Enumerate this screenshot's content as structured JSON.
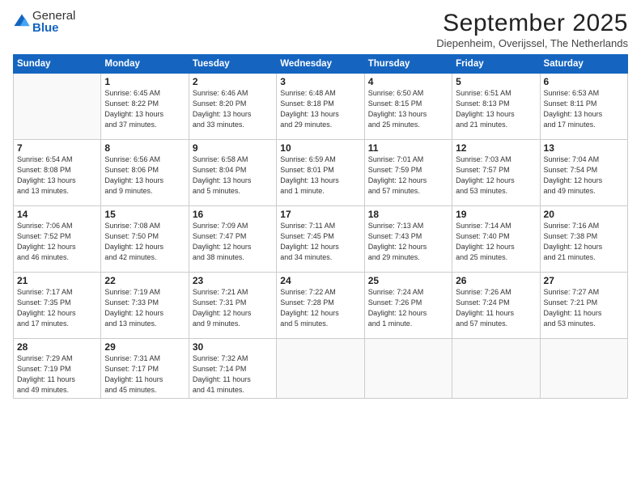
{
  "logo": {
    "general": "General",
    "blue": "Blue"
  },
  "title": "September 2025",
  "subtitle": "Diepenheim, Overijssel, The Netherlands",
  "days_of_week": [
    "Sunday",
    "Monday",
    "Tuesday",
    "Wednesday",
    "Thursday",
    "Friday",
    "Saturday"
  ],
  "weeks": [
    [
      {
        "day": "",
        "info": ""
      },
      {
        "day": "1",
        "info": "Sunrise: 6:45 AM\nSunset: 8:22 PM\nDaylight: 13 hours\nand 37 minutes."
      },
      {
        "day": "2",
        "info": "Sunrise: 6:46 AM\nSunset: 8:20 PM\nDaylight: 13 hours\nand 33 minutes."
      },
      {
        "day": "3",
        "info": "Sunrise: 6:48 AM\nSunset: 8:18 PM\nDaylight: 13 hours\nand 29 minutes."
      },
      {
        "day": "4",
        "info": "Sunrise: 6:50 AM\nSunset: 8:15 PM\nDaylight: 13 hours\nand 25 minutes."
      },
      {
        "day": "5",
        "info": "Sunrise: 6:51 AM\nSunset: 8:13 PM\nDaylight: 13 hours\nand 21 minutes."
      },
      {
        "day": "6",
        "info": "Sunrise: 6:53 AM\nSunset: 8:11 PM\nDaylight: 13 hours\nand 17 minutes."
      }
    ],
    [
      {
        "day": "7",
        "info": "Sunrise: 6:54 AM\nSunset: 8:08 PM\nDaylight: 13 hours\nand 13 minutes."
      },
      {
        "day": "8",
        "info": "Sunrise: 6:56 AM\nSunset: 8:06 PM\nDaylight: 13 hours\nand 9 minutes."
      },
      {
        "day": "9",
        "info": "Sunrise: 6:58 AM\nSunset: 8:04 PM\nDaylight: 13 hours\nand 5 minutes."
      },
      {
        "day": "10",
        "info": "Sunrise: 6:59 AM\nSunset: 8:01 PM\nDaylight: 13 hours\nand 1 minute."
      },
      {
        "day": "11",
        "info": "Sunrise: 7:01 AM\nSunset: 7:59 PM\nDaylight: 12 hours\nand 57 minutes."
      },
      {
        "day": "12",
        "info": "Sunrise: 7:03 AM\nSunset: 7:57 PM\nDaylight: 12 hours\nand 53 minutes."
      },
      {
        "day": "13",
        "info": "Sunrise: 7:04 AM\nSunset: 7:54 PM\nDaylight: 12 hours\nand 49 minutes."
      }
    ],
    [
      {
        "day": "14",
        "info": "Sunrise: 7:06 AM\nSunset: 7:52 PM\nDaylight: 12 hours\nand 46 minutes."
      },
      {
        "day": "15",
        "info": "Sunrise: 7:08 AM\nSunset: 7:50 PM\nDaylight: 12 hours\nand 42 minutes."
      },
      {
        "day": "16",
        "info": "Sunrise: 7:09 AM\nSunset: 7:47 PM\nDaylight: 12 hours\nand 38 minutes."
      },
      {
        "day": "17",
        "info": "Sunrise: 7:11 AM\nSunset: 7:45 PM\nDaylight: 12 hours\nand 34 minutes."
      },
      {
        "day": "18",
        "info": "Sunrise: 7:13 AM\nSunset: 7:43 PM\nDaylight: 12 hours\nand 29 minutes."
      },
      {
        "day": "19",
        "info": "Sunrise: 7:14 AM\nSunset: 7:40 PM\nDaylight: 12 hours\nand 25 minutes."
      },
      {
        "day": "20",
        "info": "Sunrise: 7:16 AM\nSunset: 7:38 PM\nDaylight: 12 hours\nand 21 minutes."
      }
    ],
    [
      {
        "day": "21",
        "info": "Sunrise: 7:17 AM\nSunset: 7:35 PM\nDaylight: 12 hours\nand 17 minutes."
      },
      {
        "day": "22",
        "info": "Sunrise: 7:19 AM\nSunset: 7:33 PM\nDaylight: 12 hours\nand 13 minutes."
      },
      {
        "day": "23",
        "info": "Sunrise: 7:21 AM\nSunset: 7:31 PM\nDaylight: 12 hours\nand 9 minutes."
      },
      {
        "day": "24",
        "info": "Sunrise: 7:22 AM\nSunset: 7:28 PM\nDaylight: 12 hours\nand 5 minutes."
      },
      {
        "day": "25",
        "info": "Sunrise: 7:24 AM\nSunset: 7:26 PM\nDaylight: 12 hours\nand 1 minute."
      },
      {
        "day": "26",
        "info": "Sunrise: 7:26 AM\nSunset: 7:24 PM\nDaylight: 11 hours\nand 57 minutes."
      },
      {
        "day": "27",
        "info": "Sunrise: 7:27 AM\nSunset: 7:21 PM\nDaylight: 11 hours\nand 53 minutes."
      }
    ],
    [
      {
        "day": "28",
        "info": "Sunrise: 7:29 AM\nSunset: 7:19 PM\nDaylight: 11 hours\nand 49 minutes."
      },
      {
        "day": "29",
        "info": "Sunrise: 7:31 AM\nSunset: 7:17 PM\nDaylight: 11 hours\nand 45 minutes."
      },
      {
        "day": "30",
        "info": "Sunrise: 7:32 AM\nSunset: 7:14 PM\nDaylight: 11 hours\nand 41 minutes."
      },
      {
        "day": "",
        "info": ""
      },
      {
        "day": "",
        "info": ""
      },
      {
        "day": "",
        "info": ""
      },
      {
        "day": "",
        "info": ""
      }
    ]
  ]
}
